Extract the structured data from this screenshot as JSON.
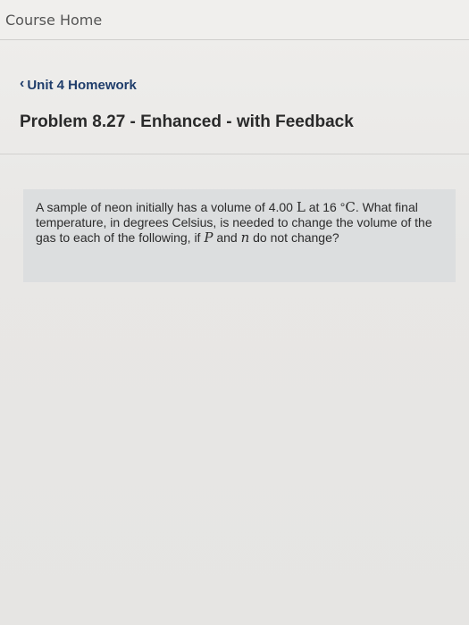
{
  "header": {
    "course_home": "Course Home"
  },
  "nav": {
    "back_label": "Unit 4 Homework"
  },
  "problem": {
    "title": "Problem 8.27 - Enhanced - with Feedback",
    "question": {
      "part1": "A sample of neon initially has a volume of 4.00 ",
      "unit_L": "L",
      "part2": " at 16 °",
      "unit_C": "C",
      "part3": ". What final temperature, in degrees Celsius, is needed to change the volume of the gas to each of the following, if ",
      "var_P": "P",
      "part4": " and ",
      "var_n": "n",
      "part5": " do not change?"
    }
  }
}
